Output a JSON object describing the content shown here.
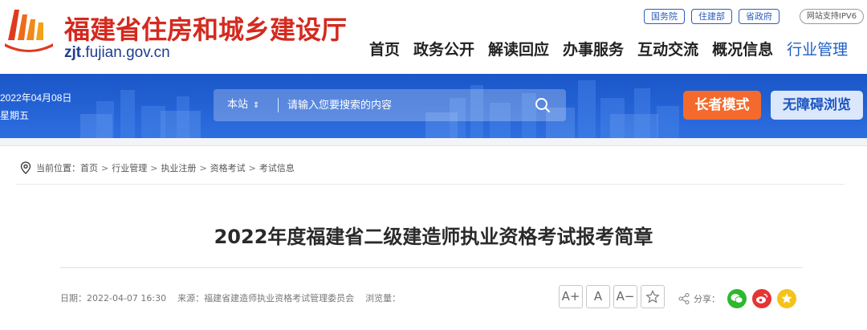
{
  "header": {
    "site_title": "福建省住房和城乡建设厅",
    "domain_bold": "zjt",
    "domain_rest": ".fujian.gov.cn",
    "top_links": [
      "国务院",
      "住建部",
      "省政府"
    ],
    "ipv6_label": "网站支持IPV6",
    "nav": [
      "首页",
      "政务公开",
      "解读回应",
      "办事服务",
      "互动交流",
      "概况信息",
      "行业管理"
    ],
    "active_nav": "行业管理"
  },
  "banner": {
    "date": "2022年04月08日",
    "weekday": "星期五",
    "search_scope": "本站",
    "search_placeholder": "请输入您要搜索的内容",
    "elder_mode_label": "长者模式",
    "accessible_label": "无障碍浏览"
  },
  "breadcrumb": {
    "prefix": "当前位置：",
    "items": [
      "首页",
      "行业管理",
      "执业注册",
      "资格考试",
      "考试信息"
    ],
    "separator": ">"
  },
  "article": {
    "title": "2022年度福建省二级建造师执业资格考试报考简章",
    "date_label": "日期：",
    "date_value": "2022-04-07 16:30",
    "source_label": "来源：",
    "source_value": "福建省建造师执业资格考试管理委员会",
    "views_label": "浏览量："
  },
  "tools": {
    "font_increase": "A+",
    "font_reset": "A",
    "font_decrease": "A−",
    "share_label": "分享："
  },
  "colors": {
    "brand_red": "#d42a1f",
    "brand_blue": "#1f5fc4",
    "banner_blue": "#2d6ee0",
    "elder_orange": "#f46a2c"
  }
}
